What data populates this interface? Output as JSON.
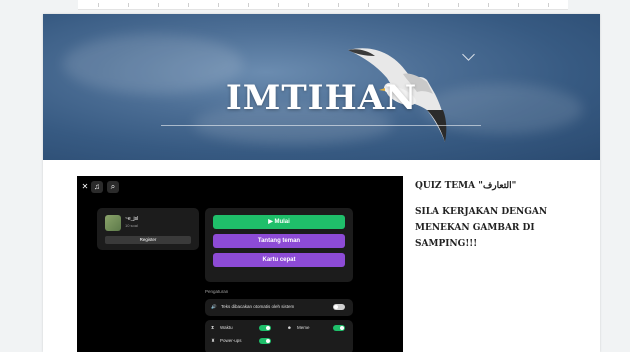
{
  "hero": {
    "title": "IMTIHAN"
  },
  "quiz_embed": {
    "toolbar": {
      "close": "✕",
      "music": "♫",
      "zoom": "⌕"
    },
    "profile": {
      "name": "~e_jsl",
      "subtitle": "10 soal",
      "login_label": "Register"
    },
    "buttons": {
      "start": "▶ Mulai",
      "challenge": "Tantang teman",
      "flashcards": "Kartu cepat"
    },
    "button_colors": {
      "start": "#1fbf6a",
      "challenge": "#8d4bd6",
      "flashcards": "#8d4bd6"
    },
    "settings": {
      "label": "Pengaturan",
      "read_aloud": "Teks dibacakan otomatis oleh sistem",
      "timer": "Waktu",
      "meme": "Meme",
      "powerups": "Power-ups"
    }
  },
  "side_text": {
    "heading": "QUIZ TEMA \"التعارف\"",
    "instruction": "SILA KERJAKAN DENGAN MENEKAN GAMBAR DI SAMPING!!!"
  }
}
